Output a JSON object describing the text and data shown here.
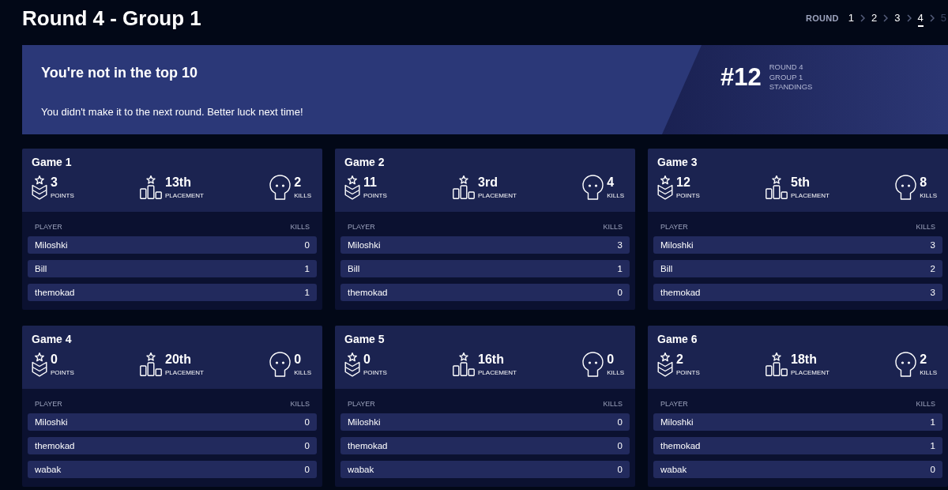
{
  "page": {
    "title": "Round 4 - Group 1"
  },
  "round_nav": {
    "label": "ROUND",
    "rounds": [
      {
        "label": "1",
        "selected": false,
        "disabled": false
      },
      {
        "label": "2",
        "selected": false,
        "disabled": false
      },
      {
        "label": "3",
        "selected": false,
        "disabled": false
      },
      {
        "label": "4",
        "selected": true,
        "disabled": false
      },
      {
        "label": "5",
        "selected": false,
        "disabled": true
      }
    ]
  },
  "banner": {
    "heading": "You're not in the top 10",
    "message": "You didn't make it to the next round. Better luck next time!",
    "rank": "#12",
    "rank_caption": [
      "ROUND 4",
      "GROUP 1",
      "STANDINGS"
    ]
  },
  "games": [
    {
      "title": "Game 1",
      "stats": [
        {
          "kind": "points",
          "value": "3",
          "label": "POINTS"
        },
        {
          "kind": "placement",
          "value": "13th",
          "label": "PLACEMENT"
        },
        {
          "kind": "kills",
          "value": "2",
          "label": "KILLS"
        }
      ],
      "columns": [
        "PLAYER",
        "KILLS"
      ],
      "rows": [
        {
          "player": "Miloshki",
          "kills": "0"
        },
        {
          "player": "Bill",
          "kills": "1"
        },
        {
          "player": "themokad",
          "kills": "1"
        }
      ]
    },
    {
      "title": "Game 2",
      "stats": [
        {
          "kind": "points",
          "value": "11",
          "label": "POINTS"
        },
        {
          "kind": "placement",
          "value": "3rd",
          "label": "PLACEMENT"
        },
        {
          "kind": "kills",
          "value": "4",
          "label": "KILLS"
        }
      ],
      "columns": [
        "PLAYER",
        "KILLS"
      ],
      "rows": [
        {
          "player": "Miloshki",
          "kills": "3"
        },
        {
          "player": "Bill",
          "kills": "1"
        },
        {
          "player": "themokad",
          "kills": "0"
        }
      ]
    },
    {
      "title": "Game 3",
      "stats": [
        {
          "kind": "points",
          "value": "12",
          "label": "POINTS"
        },
        {
          "kind": "placement",
          "value": "5th",
          "label": "PLACEMENT"
        },
        {
          "kind": "kills",
          "value": "8",
          "label": "KILLS"
        }
      ],
      "columns": [
        "PLAYER",
        "KILLS"
      ],
      "rows": [
        {
          "player": "Miloshki",
          "kills": "3"
        },
        {
          "player": "Bill",
          "kills": "2"
        },
        {
          "player": "themokad",
          "kills": "3"
        }
      ]
    },
    {
      "title": "Game 4",
      "stats": [
        {
          "kind": "points",
          "value": "0",
          "label": "POINTS"
        },
        {
          "kind": "placement",
          "value": "20th",
          "label": "PLACEMENT"
        },
        {
          "kind": "kills",
          "value": "0",
          "label": "KILLS"
        }
      ],
      "columns": [
        "PLAYER",
        "KILLS"
      ],
      "rows": [
        {
          "player": "Miloshki",
          "kills": "0"
        },
        {
          "player": "themokad",
          "kills": "0"
        },
        {
          "player": "wabak",
          "kills": "0"
        }
      ]
    },
    {
      "title": "Game 5",
      "stats": [
        {
          "kind": "points",
          "value": "0",
          "label": "POINTS"
        },
        {
          "kind": "placement",
          "value": "16th",
          "label": "PLACEMENT"
        },
        {
          "kind": "kills",
          "value": "0",
          "label": "KILLS"
        }
      ],
      "columns": [
        "PLAYER",
        "KILLS"
      ],
      "rows": [
        {
          "player": "Miloshki",
          "kills": "0"
        },
        {
          "player": "themokad",
          "kills": "0"
        },
        {
          "player": "wabak",
          "kills": "0"
        }
      ]
    },
    {
      "title": "Game 6",
      "stats": [
        {
          "kind": "points",
          "value": "2",
          "label": "POINTS"
        },
        {
          "kind": "placement",
          "value": "18th",
          "label": "PLACEMENT"
        },
        {
          "kind": "kills",
          "value": "2",
          "label": "KILLS"
        }
      ],
      "columns": [
        "PLAYER",
        "KILLS"
      ],
      "rows": [
        {
          "player": "Miloshki",
          "kills": "1"
        },
        {
          "player": "themokad",
          "kills": "1"
        },
        {
          "player": "wabak",
          "kills": "0"
        }
      ]
    }
  ]
}
